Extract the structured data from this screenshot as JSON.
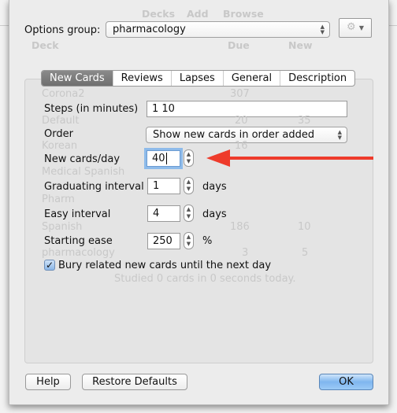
{
  "background": {
    "toolbar": [
      "Decks",
      "Add",
      "Browse"
    ],
    "columns": {
      "deck": "Deck",
      "due": "Due",
      "new": "New"
    },
    "rows": [
      {
        "name": "Corona2",
        "due": "307",
        "new": ""
      },
      {
        "name": "Default",
        "due": "20",
        "new": "35"
      },
      {
        "name": "Korean",
        "due": "16",
        "new": ""
      },
      {
        "name": "Medical Spanish",
        "due": "",
        "new": ""
      },
      {
        "name": "Pharm",
        "due": "",
        "new": ""
      },
      {
        "name": "Spanish",
        "due": "186",
        "new": "10"
      },
      {
        "name": "pharmacology",
        "due": "3",
        "new": "5"
      }
    ],
    "status": "Studied 0 cards in 0 seconds today."
  },
  "header": {
    "options_group_label": "Options group:",
    "options_group_value": "pharmacology",
    "gear_icon": "gear-icon"
  },
  "tabs": [
    {
      "label": "New Cards",
      "active": true
    },
    {
      "label": "Reviews"
    },
    {
      "label": "Lapses"
    },
    {
      "label": "General"
    },
    {
      "label": "Description"
    }
  ],
  "form": {
    "steps": {
      "label": "Steps (in minutes)",
      "value": "1 10"
    },
    "order": {
      "label": "Order",
      "value": "Show new cards in order added"
    },
    "new_per_day": {
      "label": "New cards/day",
      "value": "40"
    },
    "graduating": {
      "label": "Graduating interval",
      "value": "1",
      "unit": "days"
    },
    "easy": {
      "label": "Easy interval",
      "value": "4",
      "unit": "days"
    },
    "ease": {
      "label": "Starting ease",
      "value": "250",
      "unit": "%"
    },
    "bury": {
      "label": "Bury related new cards until the next day",
      "checked": true
    }
  },
  "annotation": {
    "arrow_color": "#ee3b2b"
  },
  "footer": {
    "help": "Help",
    "restore": "Restore Defaults",
    "ok": "OK"
  }
}
